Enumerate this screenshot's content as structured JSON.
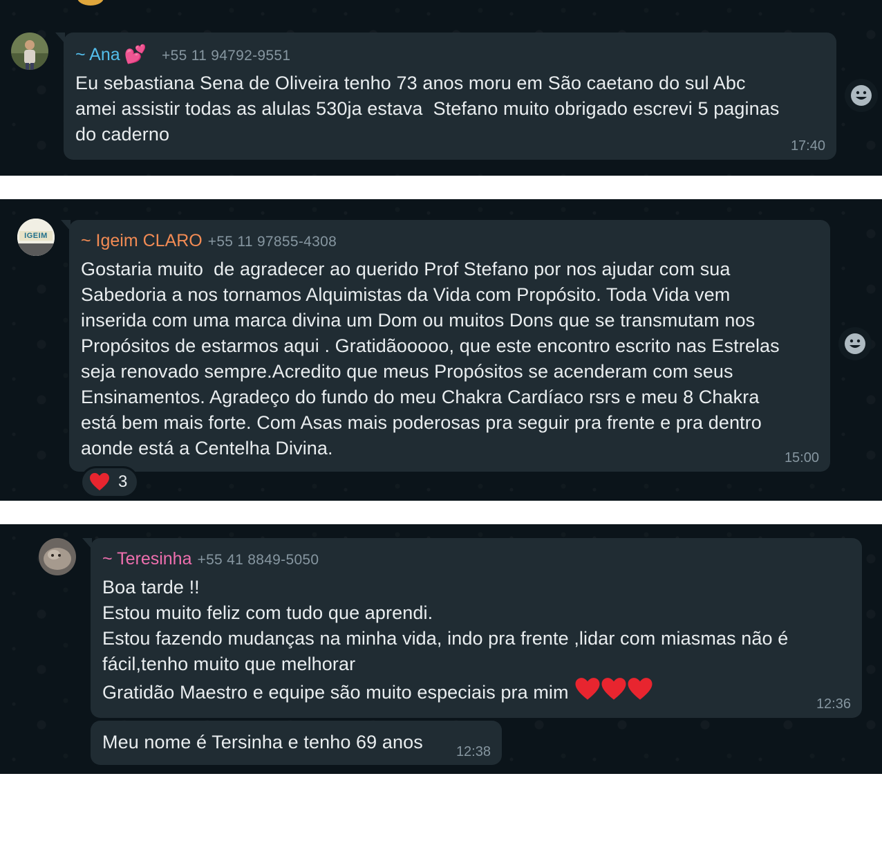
{
  "messages": [
    {
      "sender": "~ Ana",
      "sender_emoji": "💕",
      "phone": "+55 11 94792-9551",
      "text": "Eu sebastiana Sena de Oliveira tenho 73 anos moru em São caetano do sul Abc\namei assistir todas as alulas 530ja estava  Stefano muito obrigado escrevi 5 paginas\ndo caderno",
      "time": "17:40",
      "sender_color": "#53bdeb"
    },
    {
      "sender": "~ Igeim CLARO",
      "phone": "+55 11 97855-4308",
      "text": "Gostaria muito  de agradecer ao querido Prof Stefano por nos ajudar com sua\nSabedoria a nos tornamos Alquimistas da Vida com Propósito. Toda Vida vem\ninserida com uma marca divina um Dom ou muitos Dons que se transmutam nos\nPropósitos de estarmos aqui . Gratidãooooo, que este encontro escrito nas Estrelas\nseja renovado sempre.Acredito que meus Propósitos se acenderam com seus\nEnsinamentos. Agradeço do fundo do meu Chakra Cardíaco rsrs e meu 8 Chakra\nestá bem mais forte. Com Asas mais poderosas pra seguir pra frente e pra dentro\naonde está a Centelha Divina.",
      "time": "15:00",
      "reaction_count": "3",
      "avatar_text": "IGEIM",
      "sender_color": "#f28b54"
    },
    {
      "sender": "~ Teresinha",
      "phone": "+55 41 8849-5050",
      "text": "Boa tarde !!\nEstou muito feliz com tudo que aprendi.\nEstou fazendo mudanças na minha vida, indo pra frente ,lidar com miasmas não é\nfácil,tenho muito que melhorar\nGratidão Maestro e equipe são muito especiais pra mim",
      "time": "12:36",
      "sender_color": "#ee6fae"
    },
    {
      "text": "Meu nome é Tersinha e tenho 69 anos",
      "time": "12:38"
    }
  ],
  "icons": {
    "emoji_button": "smiley-icon",
    "reaction": "heart-icon",
    "hearts_inline": "heart-icon"
  },
  "colors": {
    "background": "#0b141a",
    "bubble": "#202c33",
    "text": "#e9edef",
    "meta": "#8696a0",
    "heart": "#e8252f"
  }
}
